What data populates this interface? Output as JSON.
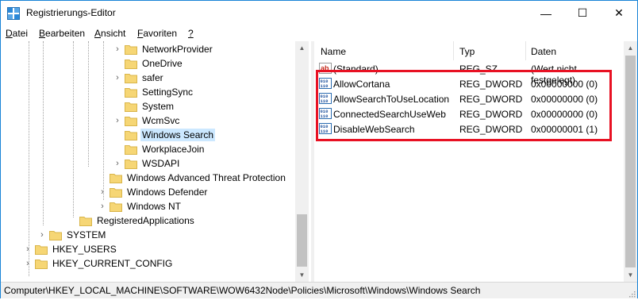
{
  "window": {
    "title": "Registrierungs-Editor",
    "icon": "registry-editor-icon",
    "accent": "#1883d7",
    "minimize_glyph": "—",
    "maximize_glyph": "☐",
    "close_glyph": "✕"
  },
  "menu": [
    {
      "accel": "D",
      "rest": "atei"
    },
    {
      "accel": "B",
      "rest": "earbeiten"
    },
    {
      "accel": "A",
      "rest": "nsicht"
    },
    {
      "accel": "F",
      "rest": "avoriten"
    },
    {
      "accel": "?",
      "rest": ""
    }
  ],
  "tree": {
    "items": [
      {
        "label": "NetworkProvider",
        "expander": "›",
        "level": 3
      },
      {
        "label": "OneDrive",
        "expander": "",
        "level": 3
      },
      {
        "label": "safer",
        "expander": "›",
        "level": 3
      },
      {
        "label": "SettingSync",
        "expander": "",
        "level": 3
      },
      {
        "label": "System",
        "expander": "",
        "level": 3
      },
      {
        "label": "WcmSvc",
        "expander": "›",
        "level": 3
      },
      {
        "label": "Windows Search",
        "expander": "",
        "level": 3,
        "selected": true
      },
      {
        "label": "WorkplaceJoin",
        "expander": "",
        "level": 3
      },
      {
        "label": "WSDAPI",
        "expander": "›",
        "level": 3
      },
      {
        "label": "Windows Advanced Threat Protection",
        "expander": "",
        "level": 2
      },
      {
        "label": "Windows Defender",
        "expander": "›",
        "level": 2
      },
      {
        "label": "Windows NT",
        "expander": "›",
        "level": 2
      },
      {
        "label": "RegisteredApplications",
        "expander": "",
        "level": 1
      },
      {
        "label": "SYSTEM",
        "expander": "›",
        "level": 0
      },
      {
        "label": "HKEY_USERS",
        "expander": "›",
        "level": -1
      },
      {
        "label": "HKEY_CURRENT_CONFIG",
        "expander": "›",
        "level": -1
      }
    ]
  },
  "list": {
    "columns": {
      "name": "Name",
      "type": "Typ",
      "data": "Daten"
    },
    "rows": [
      {
        "icon": "string-value-icon",
        "name": "(Standard)",
        "type": "REG_SZ",
        "data": "(Wert nicht festgelegt)"
      },
      {
        "icon": "dword-value-icon",
        "name": "AllowCortana",
        "type": "REG_DWORD",
        "data": "0x00000000 (0)"
      },
      {
        "icon": "dword-value-icon",
        "name": "AllowSearchToUseLocation",
        "type": "REG_DWORD",
        "data": "0x00000000 (0)"
      },
      {
        "icon": "dword-value-icon",
        "name": "ConnectedSearchUseWeb",
        "type": "REG_DWORD",
        "data": "0x00000000 (0)"
      },
      {
        "icon": "dword-value-icon",
        "name": "DisableWebSearch",
        "type": "REG_DWORD",
        "data": "0x00000001 (1)"
      }
    ],
    "highlight_color": "#e81123"
  },
  "status": {
    "path": "Computer\\HKEY_LOCAL_MACHINE\\SOFTWARE\\WOW6432Node\\Policies\\Microsoft\\Windows\\Windows Search"
  },
  "colors": {
    "selection": "#cce8ff",
    "folder": "#f6d675",
    "scrollbar_thumb": "#c2c2c2"
  }
}
